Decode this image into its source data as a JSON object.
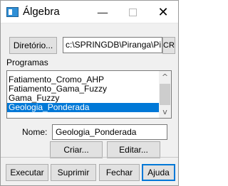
{
  "window": {
    "title": "Álgebra",
    "icon": "app-window-icon",
    "controls": {
      "minimize": "—",
      "maximize": "☐",
      "close": "✕"
    }
  },
  "directory": {
    "button_label": "Diretório...",
    "path": "c:\\SPRINGDB\\Piranga\\Pi",
    "cr_label": "CR"
  },
  "programs": {
    "label": "Programas",
    "items": [
      {
        "label": "Fatiamento_Cromo_AHP",
        "selected": false
      },
      {
        "label": "Fatiamento_Gama_Fuzzy",
        "selected": false
      },
      {
        "label": "Gama_Fuzzy",
        "selected": false
      },
      {
        "label": "Geologia_Ponderada",
        "selected": true
      }
    ],
    "scroll_up": "^",
    "scroll_down": "v"
  },
  "name": {
    "label": "Nome:",
    "value": "Geologia_Ponderada"
  },
  "actions": {
    "create": "Criar...",
    "edit": "Editar..."
  },
  "footer": {
    "execute": "Executar",
    "delete": "Suprimir",
    "close": "Fechar",
    "help": "Ajuda"
  },
  "colors": {
    "accent": "#0078d7",
    "window_bg": "#f0f0f0",
    "button_bg": "#e1e1e1"
  }
}
